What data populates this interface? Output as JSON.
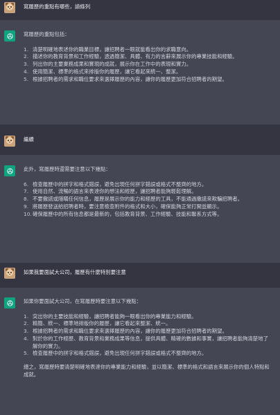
{
  "conversation": [
    {
      "role": "user",
      "text": "寫履歷的重點有哪些，請條列"
    },
    {
      "role": "assistant",
      "intro": "寫履歷的重點包括：",
      "items": [
        {
          "n": "1.",
          "text": "清楚明確地表述你的職業目標，讓招聘者一眼就能看出你的求職意向。"
        },
        {
          "n": "2.",
          "text": "描述你的教育背景和工作經驗，透過簡潔、具體、有力的言辭來展示你的專業技能和經驗。"
        },
        {
          "n": "3.",
          "text": "列出你的主要業務成果和實現的成就，展示你在工作中的表現和實力。"
        },
        {
          "n": "4.",
          "text": "使用簡潔、標準的格式來排版你的履歷，讓它看起來統一、整潔。"
        },
        {
          "n": "5.",
          "text": "根據招聘者的需求和職位要求來選擇履歷的內容，讓你的履歷更加符合招聘者的期望。"
        }
      ]
    },
    {
      "role": "user",
      "text": "繼續"
    },
    {
      "role": "assistant",
      "intro": "此外，寫履歷時還需要注意以下幾點：",
      "items": [
        {
          "n": "6.",
          "text": "檢查履歷中的拼字和格式錯誤，避免出現任何拼字錯誤或格式不整齊的地方。"
        },
        {
          "n": "7.",
          "text": "使用自然、流暢的語言來表達你的想法和經歷，讓招聘者能夠輕鬆理解。"
        },
        {
          "n": "8.",
          "text": "不要撒謊或隱瞞任何信息，履歷是展示你的能力和經歷的工具，不能通過撒謊來欺騙招聘者。"
        },
        {
          "n": "9.",
          "text": "將履歷發送給招聘者時，要注意檢查附件的格式和大小，確保能夠正常打開並顯示。"
        },
        {
          "n": "10.",
          "text": "確保履歷中的所有信息都是最新的，包括教育背景、工作經驗、技能和聯系方式等。"
        }
      ]
    },
    {
      "role": "user",
      "text": "如果我要面試大公司，履歷有什麼特別要注意"
    },
    {
      "role": "assistant",
      "intro": "如果你要面試大公司，在寫履歷時要注意以下幾點：",
      "items": [
        {
          "n": "1.",
          "text": "突出你的主要技能和經驗，讓招聘者能夠一眼看出你的專業能力和經驗。"
        },
        {
          "n": "2.",
          "text": "精簡、統一、標準地排版你的履歷，讓它看起來整潔、統一。"
        },
        {
          "n": "3.",
          "text": "根據招聘者的需求和職位要求來選擇履歷的內容，讓你的履歷更加符合招聘者的期望。"
        },
        {
          "n": "4.",
          "text": "對於你的工作經歷、教育背景和業務成果等信息，提供具體、精確的數據和事實，讓招聘者能夠清楚地了解你的實力。"
        },
        {
          "n": "5.",
          "text": "檢查履歷中的拼字和格式錯誤，避免出現任何拼字錯誤或格式不整齊的地方。"
        }
      ],
      "outro": "總之，寫履歷時要清楚明確地表達你的專業能力和經驗，並以簡潔、標準的格式和語言來展示你的個人特點和成就。"
    }
  ],
  "colors": {
    "user_bg": "#343541",
    "assistant_bg": "#444654",
    "gpt_accent": "#10a37f"
  },
  "icons": {
    "user_avatar": "cat-avatar-icon",
    "assistant_avatar": "openai-logo-icon"
  }
}
